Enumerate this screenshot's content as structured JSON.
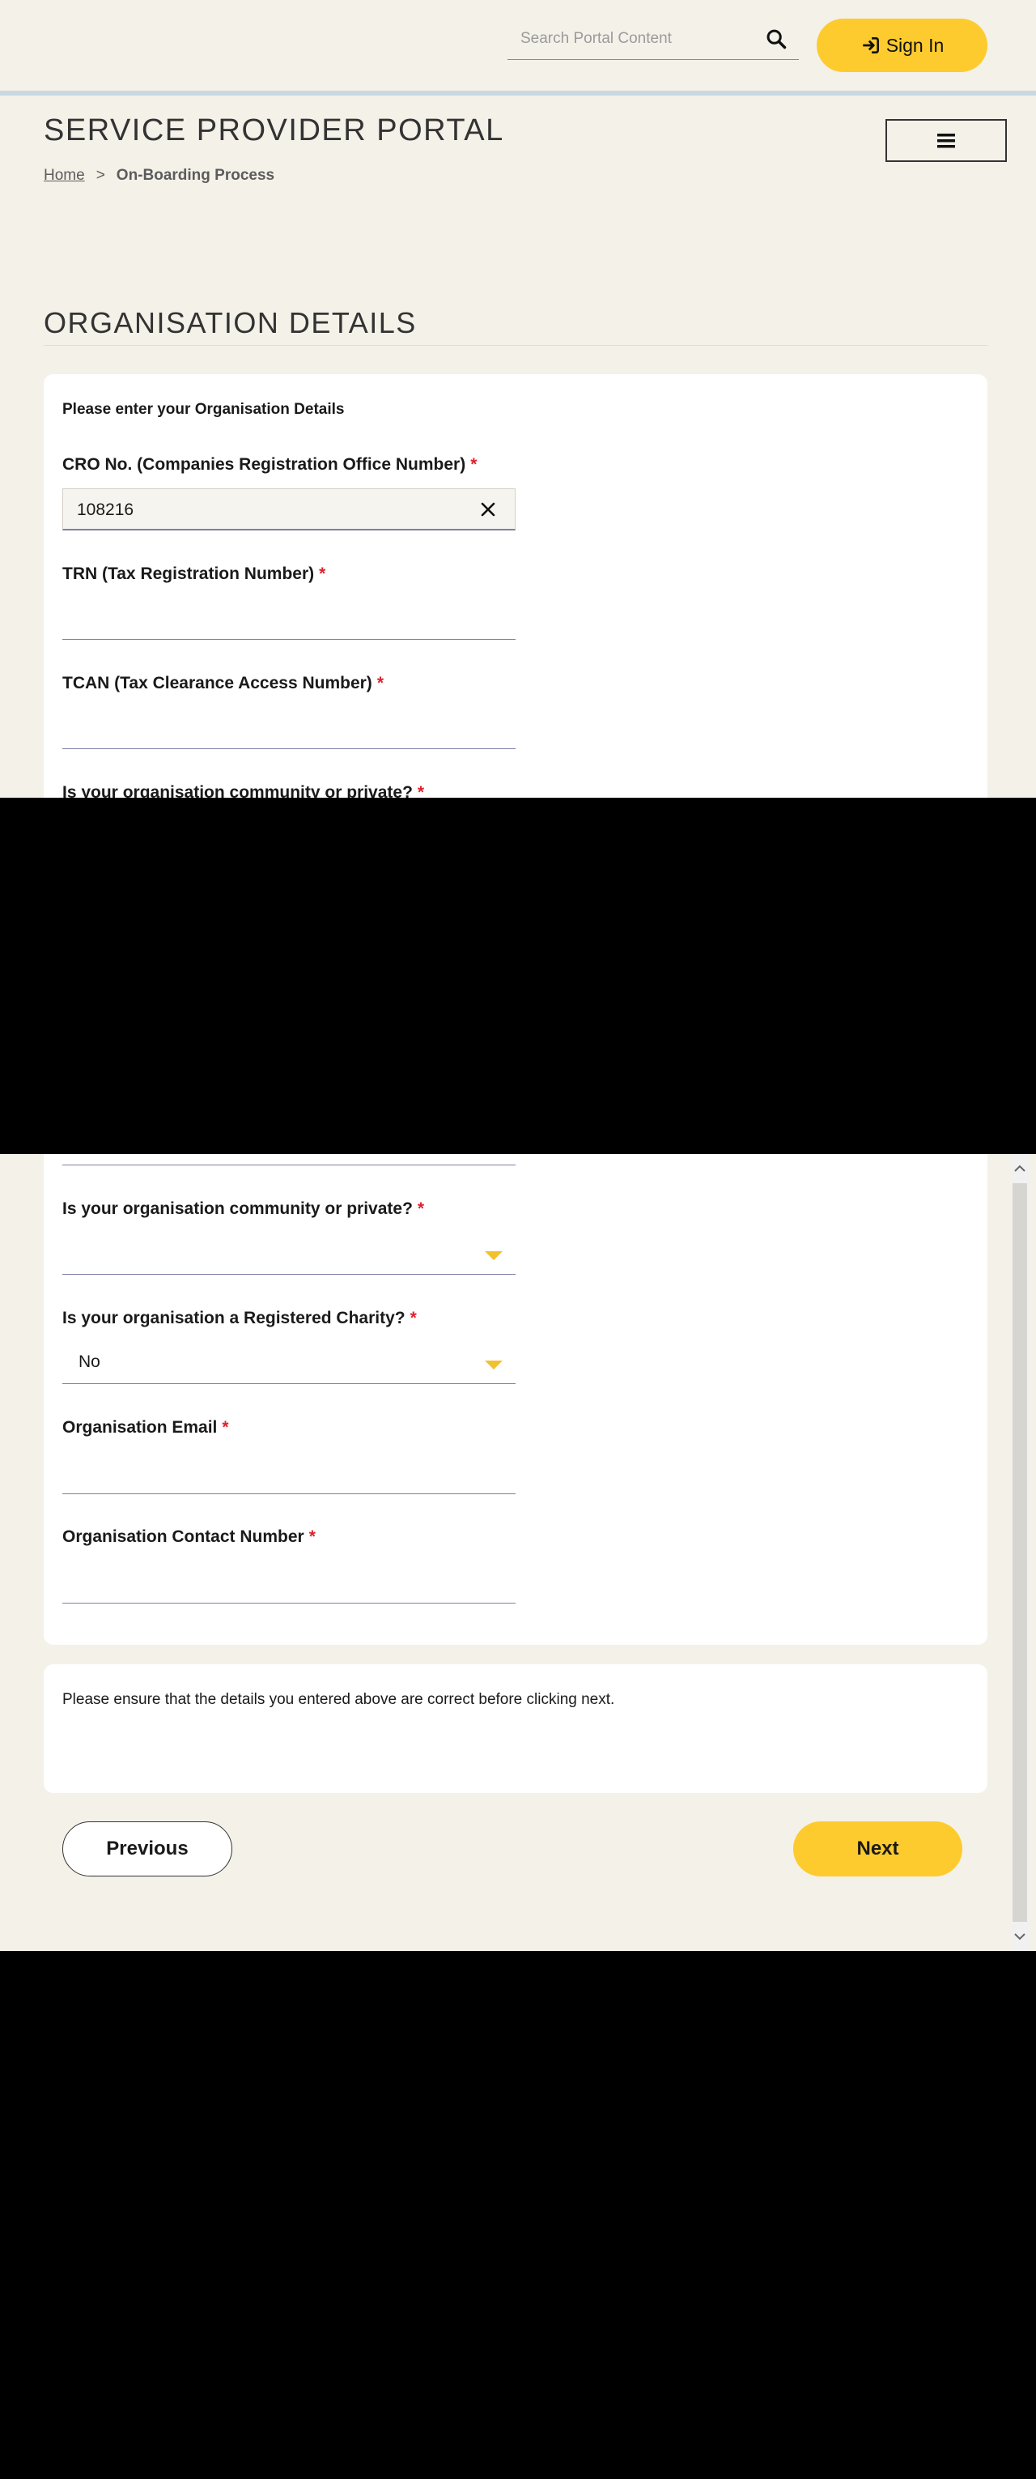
{
  "header": {
    "search_placeholder": "Search Portal Content",
    "sign_in_label": "Sign In",
    "portal_title": "SERVICE PROVIDER PORTAL",
    "menu_icon": "hamburger-icon"
  },
  "breadcrumb": {
    "home": "Home",
    "separator": ">",
    "current": "On-Boarding Process"
  },
  "form": {
    "section_title": "ORGANISATION DETAILS",
    "intro": "Please enter your Organisation Details",
    "required_marker": "*",
    "fields": {
      "cro": {
        "label": "CRO No. (Companies Registration Office Number)",
        "value": "108216"
      },
      "trn": {
        "label": "TRN (Tax Registration Number)",
        "value": ""
      },
      "tcan": {
        "label": "TCAN (Tax Clearance Access Number)",
        "value": ""
      },
      "community": {
        "label": "Is your organisation community or private?",
        "value": ""
      },
      "charity": {
        "label": "Is your organisation a Registered Charity?",
        "value": "No"
      },
      "email": {
        "label": "Organisation Email",
        "value": ""
      },
      "contact": {
        "label": "Organisation Contact Number",
        "value": ""
      }
    },
    "notice": "Please ensure that the details you entered above are correct before clicking next.",
    "previous_label": "Previous",
    "next_label": "Next"
  },
  "colors": {
    "background": "#f4f1e9",
    "accent_yellow": "#fdcb2d",
    "required_red": "#e0202e",
    "field_underline": "#7f7fa8"
  }
}
